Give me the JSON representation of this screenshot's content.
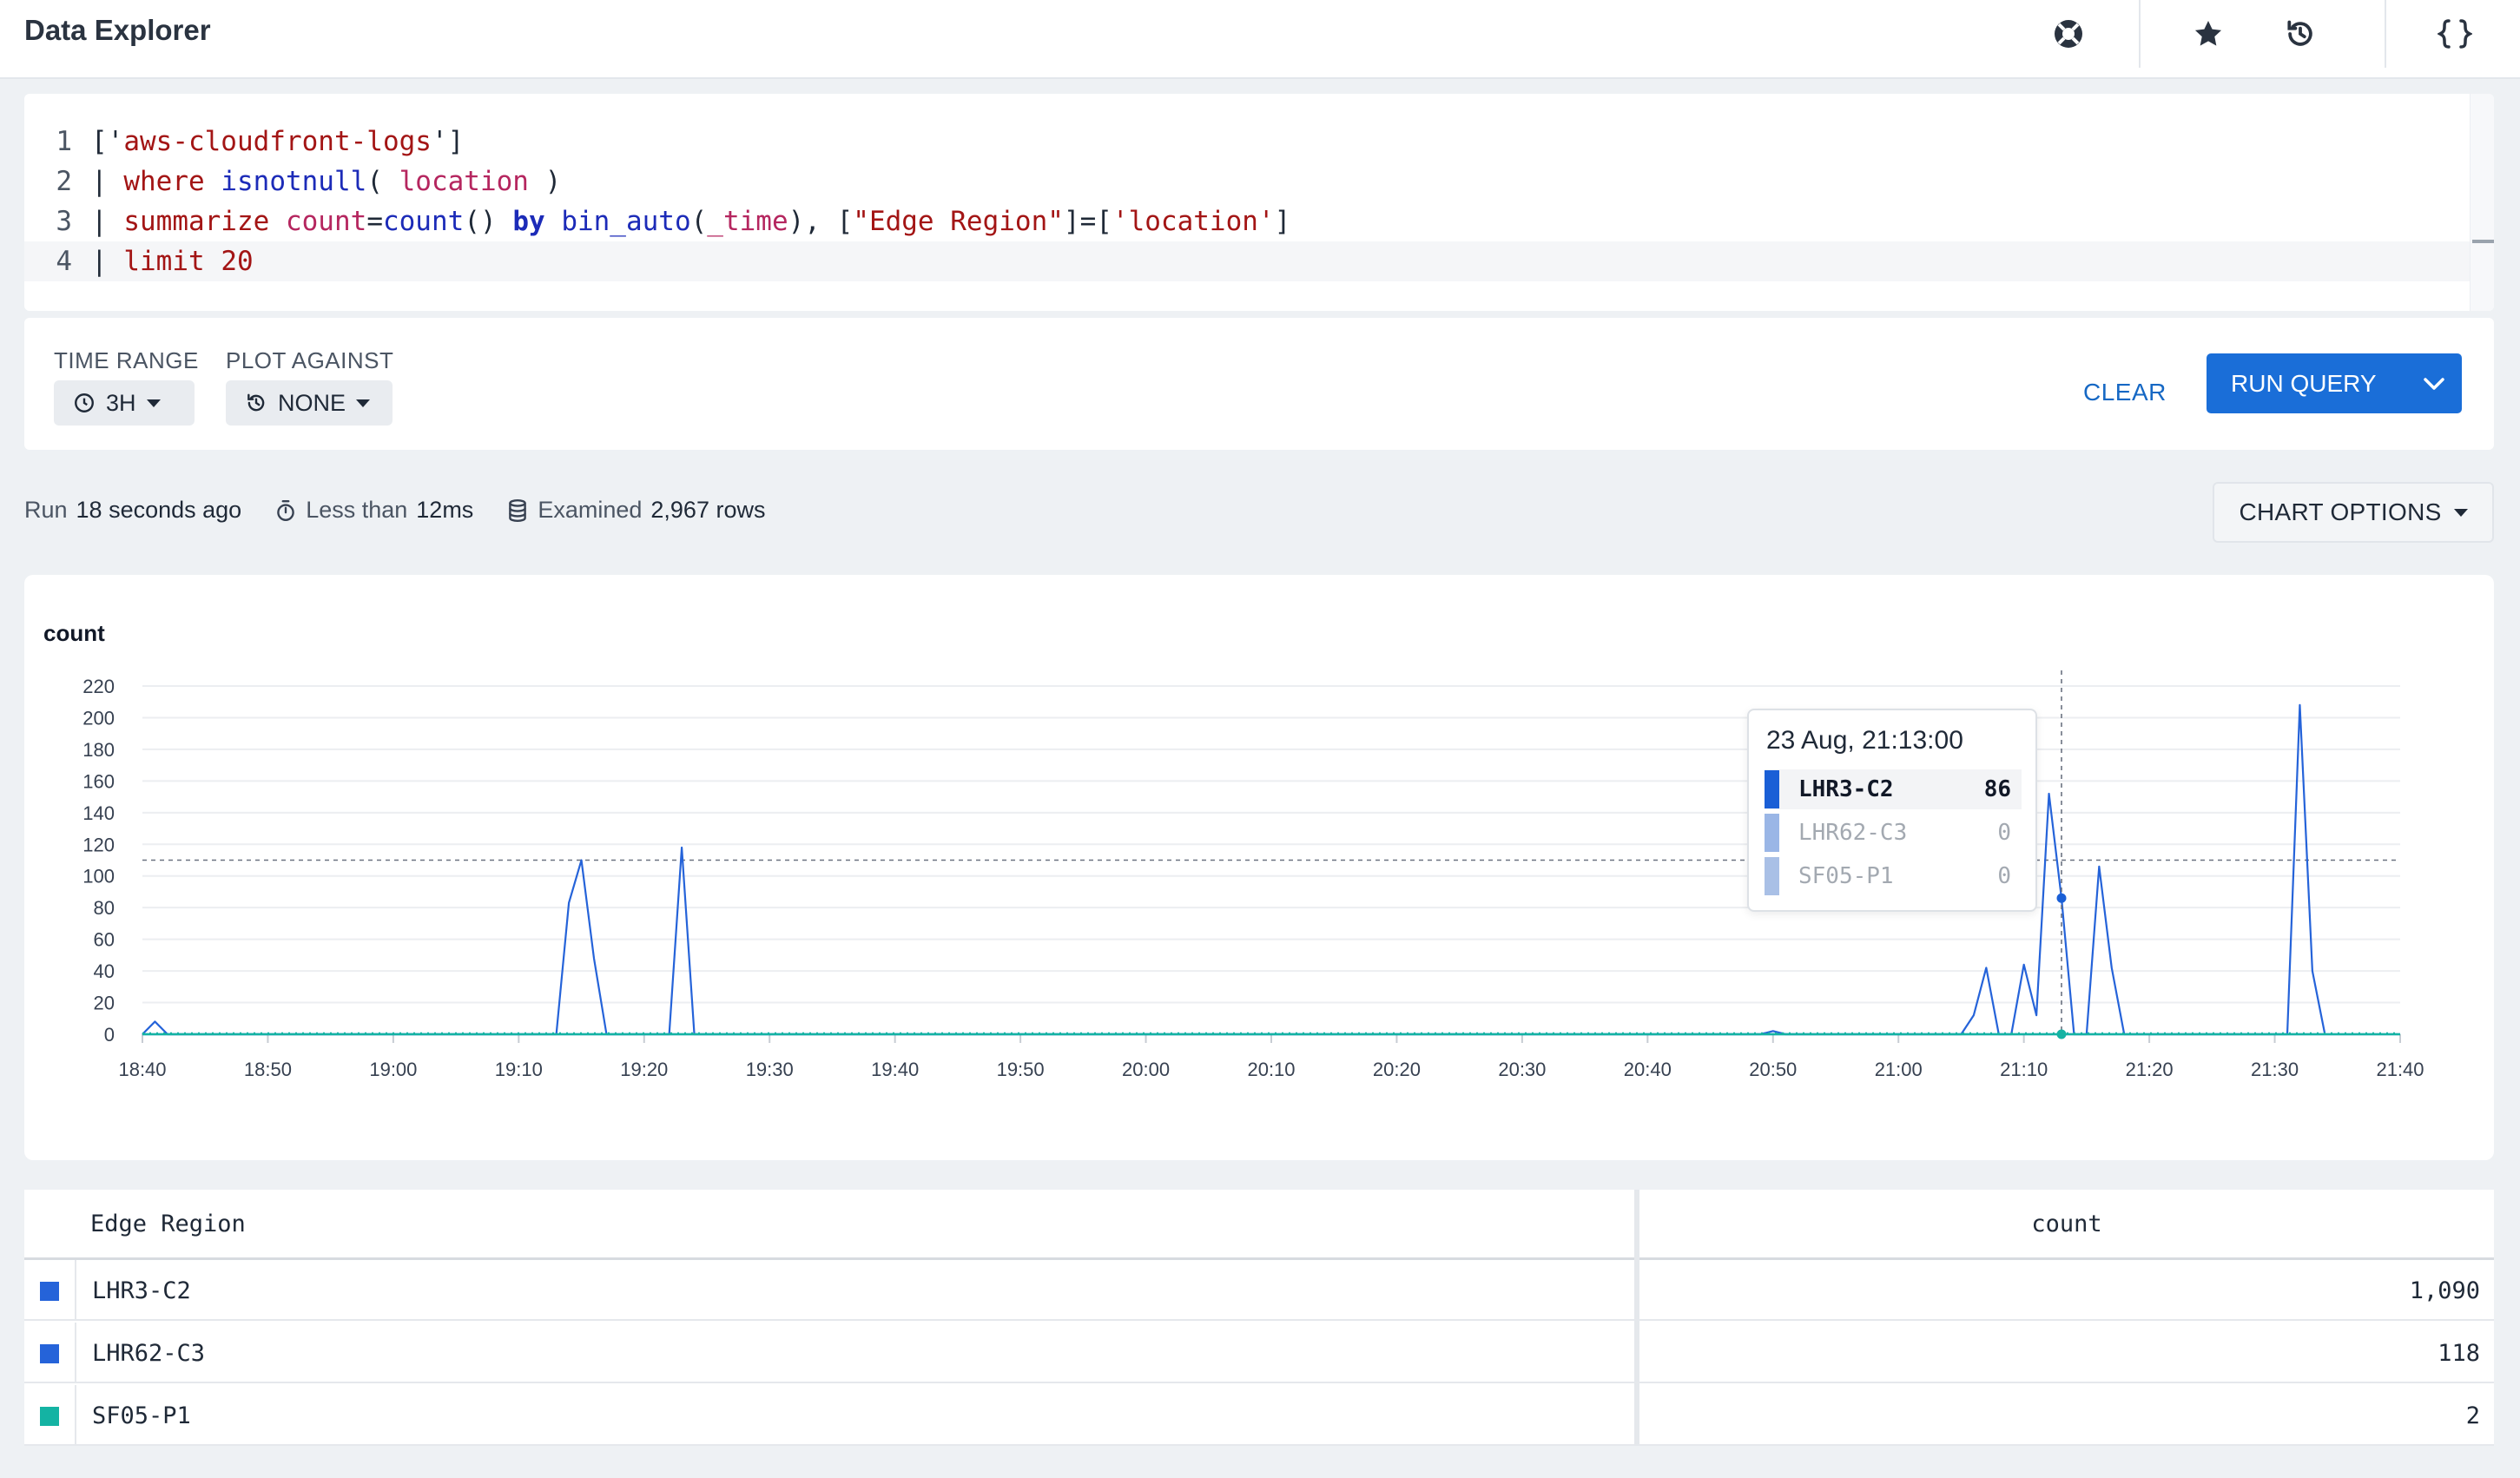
{
  "header": {
    "title": "Data Explorer",
    "icons": [
      "help-lifebuoy-icon",
      "star-icon",
      "history-icon",
      "braces-icon"
    ]
  },
  "editor": {
    "line_numbers": [
      "1",
      "2",
      "3",
      "4"
    ],
    "lines": [
      [
        "['",
        "aws-cloudfront-logs",
        "']"
      ],
      [
        "| ",
        "where",
        " ",
        "isnotnull",
        "( ",
        "location",
        " )"
      ],
      [
        "| ",
        "summarize",
        " ",
        "count",
        "=",
        "count",
        "() ",
        "by",
        " ",
        "bin_auto",
        "(",
        "_time",
        "), [",
        "\"Edge Region\"",
        "]=[",
        "'location'",
        "]"
      ],
      [
        "| ",
        "limit",
        " ",
        "20"
      ]
    ]
  },
  "controls": {
    "time_range_label": "TIME RANGE",
    "time_range_value": "3H",
    "plot_against_label": "PLOT AGAINST",
    "plot_against_value": "NONE",
    "clear_label": "CLEAR",
    "run_label": "RUN QUERY"
  },
  "status": {
    "run_prefix": "Run",
    "run_value": "18 seconds ago",
    "duration_prefix": "Less than",
    "duration_value": "12ms",
    "examined_prefix": "Examined",
    "examined_value": "2,967 rows",
    "chart_options_label": "CHART OPTIONS"
  },
  "colors": {
    "series_lhr3": "#2563d9",
    "series_lhr62": "#2563d9",
    "series_sf05": "#14b3a3",
    "accent": "#1a6ed8"
  },
  "chart_data": {
    "type": "line",
    "ylabel": "count",
    "y_ticks": [
      "0",
      "20",
      "40",
      "60",
      "80",
      "100",
      "120",
      "140",
      "160",
      "180",
      "200",
      "220"
    ],
    "ylim": [
      0,
      220
    ],
    "x_ticks": [
      "18:40",
      "18:50",
      "19:00",
      "19:10",
      "19:20",
      "19:30",
      "19:40",
      "19:50",
      "20:00",
      "20:10",
      "20:20",
      "20:30",
      "20:40",
      "20:50",
      "21:00",
      "21:10",
      "21:20",
      "21:30",
      "21:40"
    ],
    "xlim": [
      "18:40",
      "21:40"
    ],
    "reference_line": 110,
    "series": [
      {
        "name": "LHR3-C2",
        "points": [
          [
            "18:40",
            0
          ],
          [
            "18:41",
            8
          ],
          [
            "18:42",
            0
          ],
          [
            "19:13",
            0
          ],
          [
            "19:14",
            83
          ],
          [
            "19:15",
            110
          ],
          [
            "19:16",
            48
          ],
          [
            "19:17",
            0
          ],
          [
            "19:22",
            0
          ],
          [
            "19:23",
            118
          ],
          [
            "19:24",
            0
          ],
          [
            "21:05",
            0
          ],
          [
            "21:06",
            12
          ],
          [
            "21:07",
            42
          ],
          [
            "21:08",
            0
          ],
          [
            "21:09",
            0
          ],
          [
            "21:10",
            44
          ],
          [
            "21:11",
            12
          ],
          [
            "21:12",
            152
          ],
          [
            "21:13",
            86
          ],
          [
            "21:14",
            0
          ],
          [
            "21:15",
            0
          ],
          [
            "21:16",
            106
          ],
          [
            "21:17",
            42
          ],
          [
            "21:18",
            0
          ],
          [
            "21:31",
            0
          ],
          [
            "21:32",
            208
          ],
          [
            "21:33",
            40
          ],
          [
            "21:34",
            0
          ]
        ]
      },
      {
        "name": "LHR62-C3",
        "points": [
          [
            "18:40",
            0
          ],
          [
            "20:49",
            0
          ],
          [
            "20:50",
            2
          ],
          [
            "20:51",
            0
          ],
          [
            "21:40",
            0
          ]
        ]
      },
      {
        "name": "SF05-P1",
        "points": [
          [
            "18:40",
            0
          ],
          [
            "21:40",
            0
          ]
        ]
      }
    ],
    "tooltip": {
      "date": "23 Aug, 21:13:00",
      "rows": [
        {
          "name": "LHR3-C2",
          "value": "86"
        },
        {
          "name": "LHR62-C3",
          "value": "0"
        },
        {
          "name": "SF05-P1",
          "value": "0"
        }
      ]
    }
  },
  "table": {
    "columns": [
      "Edge Region",
      "count"
    ],
    "rows": [
      {
        "name": "LHR3-C2",
        "count": "1,090"
      },
      {
        "name": "LHR62-C3",
        "count": "118"
      },
      {
        "name": "SF05-P1",
        "count": "2"
      }
    ]
  }
}
